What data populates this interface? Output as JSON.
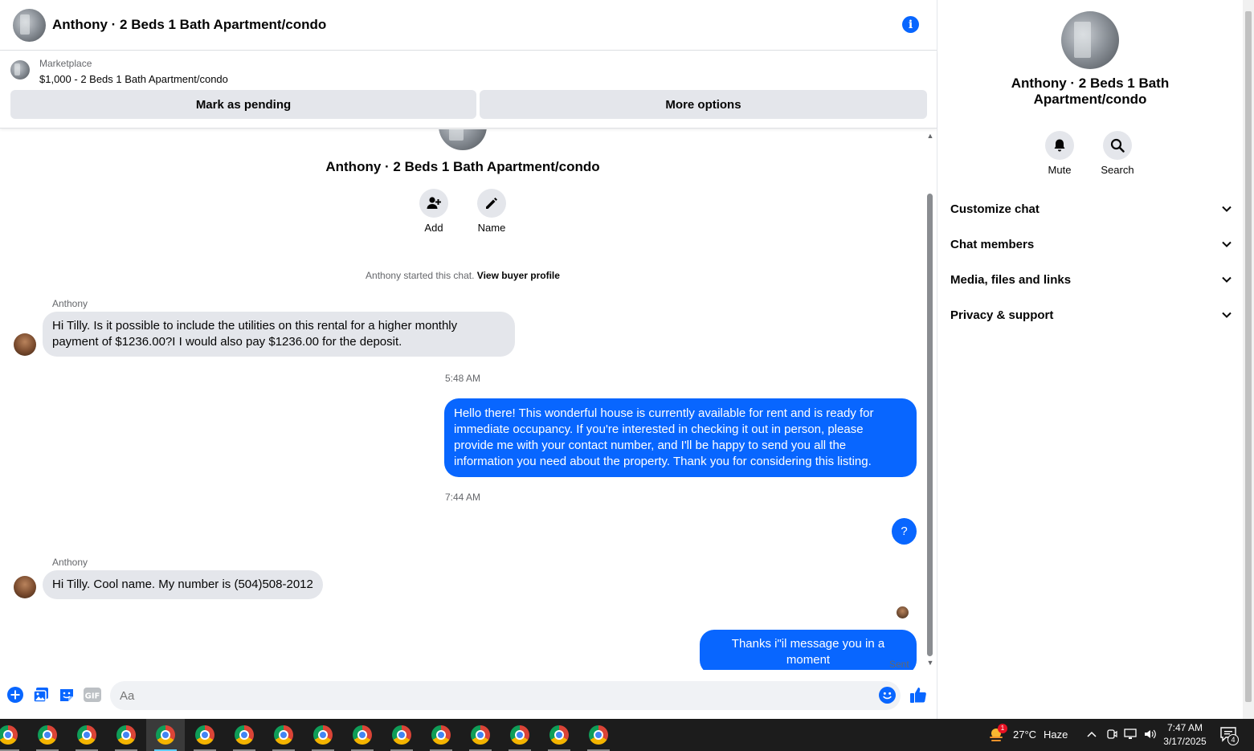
{
  "header": {
    "title": "Anthony · 2 Beds 1 Bath Apartment/condo"
  },
  "listing": {
    "kicker": "Marketplace",
    "name": "$1,000 - 2 Beds 1 Bath Apartment/condo",
    "pending_label": "Mark as pending",
    "more_label": "More options"
  },
  "thread_intro": {
    "title": "Anthony · 2 Beds 1 Bath Apartment/condo",
    "add_label": "Add",
    "name_label": "Name",
    "started_text": "Anthony started this chat.",
    "view_profile_label": "View buyer profile"
  },
  "messages": [
    {
      "sender": "Anthony",
      "text_line1": "Hi Tilly. Is it possible to include the utilities on this rental for a higher monthly",
      "text_line2": "payment of $1236.00?I I would also pay $1236.00 for the deposit."
    },
    {
      "time": "5:48 AM"
    },
    {
      "lines": [
        "Hello there! This wonderful house is currently available for rent and is ready for",
        "immediate occupancy. If you're interested in checking it out in person, please",
        "provide me with your contact number, and I'll be happy to send you all the",
        "information you need about the property. Thank you for considering this listing."
      ]
    },
    {
      "time": "7:44 AM"
    },
    {
      "text": "?"
    },
    {
      "sender": "Anthony",
      "text": "Hi Tilly. Cool name. My number is (504)508-2012"
    },
    {
      "text": "Thanks i\"il message you in a moment",
      "status": "Sent"
    }
  ],
  "composer": {
    "placeholder": "Aa"
  },
  "panel": {
    "title": "Anthony · 2 Beds 1 Bath Apartment/condo",
    "mute_label": "Mute",
    "search_label": "Search",
    "sections": [
      "Customize chat",
      "Chat members",
      "Media, files and links",
      "Privacy & support"
    ]
  },
  "taskbar": {
    "weather_temp": "27°C",
    "weather_desc": "Haze",
    "weather_badge": "1",
    "time": "7:47 AM",
    "date": "3/17/2025",
    "notification_count": "4"
  },
  "colors": {
    "accent": "#0866ff",
    "bubble_in": "#e4e6eb",
    "taskbar": "#1c1c1c"
  }
}
